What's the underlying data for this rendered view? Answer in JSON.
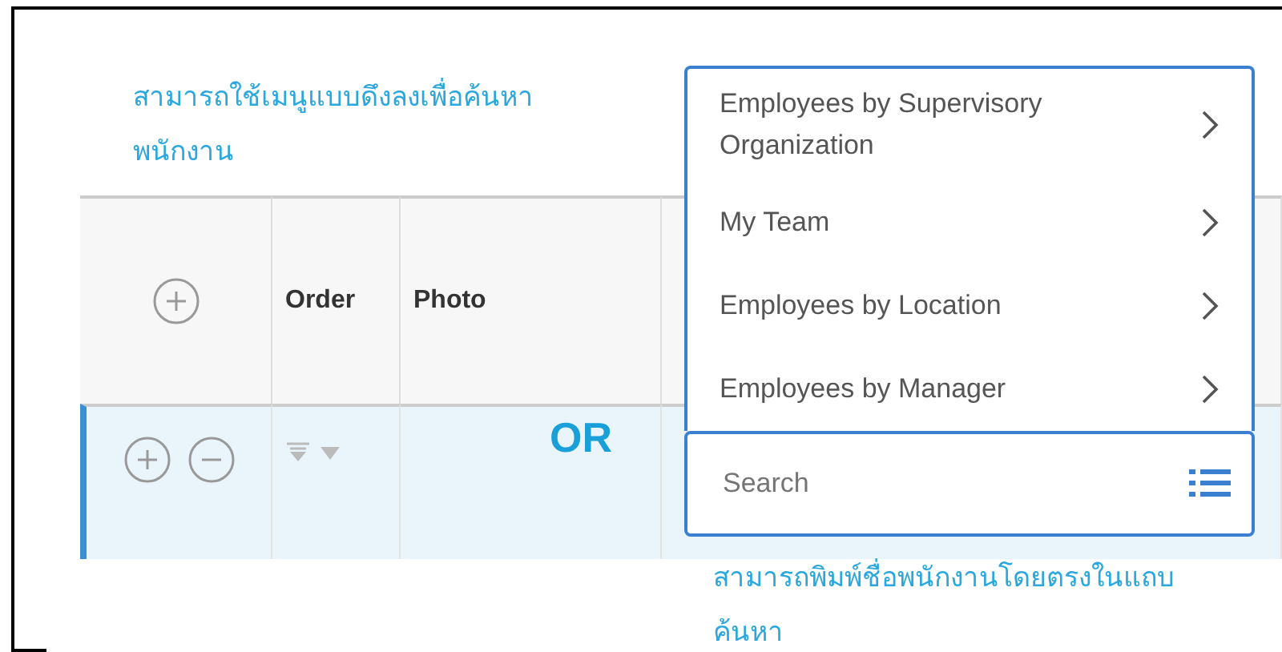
{
  "top_note": "สามารถใช้เมนูแบบดึงลงเพื่อค้นหาพนักงาน",
  "bottom_note": "สามารถพิมพ์ชื่อพนักงานโดยตรงในแถบค้นหา",
  "table": {
    "columns": [
      {
        "kind": "add"
      },
      {
        "kind": "text",
        "label": "Order"
      },
      {
        "kind": "text",
        "label": "Photo"
      },
      {
        "kind": "empty"
      }
    ],
    "rows": [
      {
        "selected": true
      }
    ]
  },
  "or_label": "OR",
  "dropdown": {
    "items": [
      {
        "label": "Employees by Supervisory Organization"
      },
      {
        "label": "My Team"
      },
      {
        "label": "Employees by Location"
      },
      {
        "label": "Employees by Manager"
      }
    ],
    "search": {
      "placeholder": "Search"
    }
  }
}
